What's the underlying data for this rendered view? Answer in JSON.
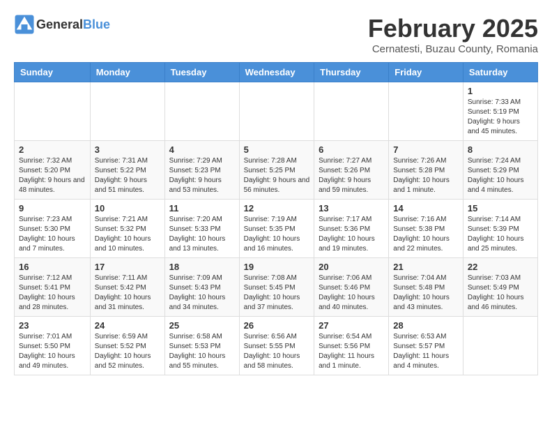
{
  "header": {
    "logo_general": "General",
    "logo_blue": "Blue",
    "title": "February 2025",
    "subtitle": "Cernatesti, Buzau County, Romania"
  },
  "weekdays": [
    "Sunday",
    "Monday",
    "Tuesday",
    "Wednesday",
    "Thursday",
    "Friday",
    "Saturday"
  ],
  "weeks": [
    [
      {
        "day": "",
        "info": ""
      },
      {
        "day": "",
        "info": ""
      },
      {
        "day": "",
        "info": ""
      },
      {
        "day": "",
        "info": ""
      },
      {
        "day": "",
        "info": ""
      },
      {
        "day": "",
        "info": ""
      },
      {
        "day": "1",
        "info": "Sunrise: 7:33 AM\nSunset: 5:19 PM\nDaylight: 9 hours and 45 minutes."
      }
    ],
    [
      {
        "day": "2",
        "info": "Sunrise: 7:32 AM\nSunset: 5:20 PM\nDaylight: 9 hours and 48 minutes."
      },
      {
        "day": "3",
        "info": "Sunrise: 7:31 AM\nSunset: 5:22 PM\nDaylight: 9 hours and 51 minutes."
      },
      {
        "day": "4",
        "info": "Sunrise: 7:29 AM\nSunset: 5:23 PM\nDaylight: 9 hours and 53 minutes."
      },
      {
        "day": "5",
        "info": "Sunrise: 7:28 AM\nSunset: 5:25 PM\nDaylight: 9 hours and 56 minutes."
      },
      {
        "day": "6",
        "info": "Sunrise: 7:27 AM\nSunset: 5:26 PM\nDaylight: 9 hours and 59 minutes."
      },
      {
        "day": "7",
        "info": "Sunrise: 7:26 AM\nSunset: 5:28 PM\nDaylight: 10 hours and 1 minute."
      },
      {
        "day": "8",
        "info": "Sunrise: 7:24 AM\nSunset: 5:29 PM\nDaylight: 10 hours and 4 minutes."
      }
    ],
    [
      {
        "day": "9",
        "info": "Sunrise: 7:23 AM\nSunset: 5:30 PM\nDaylight: 10 hours and 7 minutes."
      },
      {
        "day": "10",
        "info": "Sunrise: 7:21 AM\nSunset: 5:32 PM\nDaylight: 10 hours and 10 minutes."
      },
      {
        "day": "11",
        "info": "Sunrise: 7:20 AM\nSunset: 5:33 PM\nDaylight: 10 hours and 13 minutes."
      },
      {
        "day": "12",
        "info": "Sunrise: 7:19 AM\nSunset: 5:35 PM\nDaylight: 10 hours and 16 minutes."
      },
      {
        "day": "13",
        "info": "Sunrise: 7:17 AM\nSunset: 5:36 PM\nDaylight: 10 hours and 19 minutes."
      },
      {
        "day": "14",
        "info": "Sunrise: 7:16 AM\nSunset: 5:38 PM\nDaylight: 10 hours and 22 minutes."
      },
      {
        "day": "15",
        "info": "Sunrise: 7:14 AM\nSunset: 5:39 PM\nDaylight: 10 hours and 25 minutes."
      }
    ],
    [
      {
        "day": "16",
        "info": "Sunrise: 7:12 AM\nSunset: 5:41 PM\nDaylight: 10 hours and 28 minutes."
      },
      {
        "day": "17",
        "info": "Sunrise: 7:11 AM\nSunset: 5:42 PM\nDaylight: 10 hours and 31 minutes."
      },
      {
        "day": "18",
        "info": "Sunrise: 7:09 AM\nSunset: 5:43 PM\nDaylight: 10 hours and 34 minutes."
      },
      {
        "day": "19",
        "info": "Sunrise: 7:08 AM\nSunset: 5:45 PM\nDaylight: 10 hours and 37 minutes."
      },
      {
        "day": "20",
        "info": "Sunrise: 7:06 AM\nSunset: 5:46 PM\nDaylight: 10 hours and 40 minutes."
      },
      {
        "day": "21",
        "info": "Sunrise: 7:04 AM\nSunset: 5:48 PM\nDaylight: 10 hours and 43 minutes."
      },
      {
        "day": "22",
        "info": "Sunrise: 7:03 AM\nSunset: 5:49 PM\nDaylight: 10 hours and 46 minutes."
      }
    ],
    [
      {
        "day": "23",
        "info": "Sunrise: 7:01 AM\nSunset: 5:50 PM\nDaylight: 10 hours and 49 minutes."
      },
      {
        "day": "24",
        "info": "Sunrise: 6:59 AM\nSunset: 5:52 PM\nDaylight: 10 hours and 52 minutes."
      },
      {
        "day": "25",
        "info": "Sunrise: 6:58 AM\nSunset: 5:53 PM\nDaylight: 10 hours and 55 minutes."
      },
      {
        "day": "26",
        "info": "Sunrise: 6:56 AM\nSunset: 5:55 PM\nDaylight: 10 hours and 58 minutes."
      },
      {
        "day": "27",
        "info": "Sunrise: 6:54 AM\nSunset: 5:56 PM\nDaylight: 11 hours and 1 minute."
      },
      {
        "day": "28",
        "info": "Sunrise: 6:53 AM\nSunset: 5:57 PM\nDaylight: 11 hours and 4 minutes."
      },
      {
        "day": "",
        "info": ""
      }
    ]
  ]
}
